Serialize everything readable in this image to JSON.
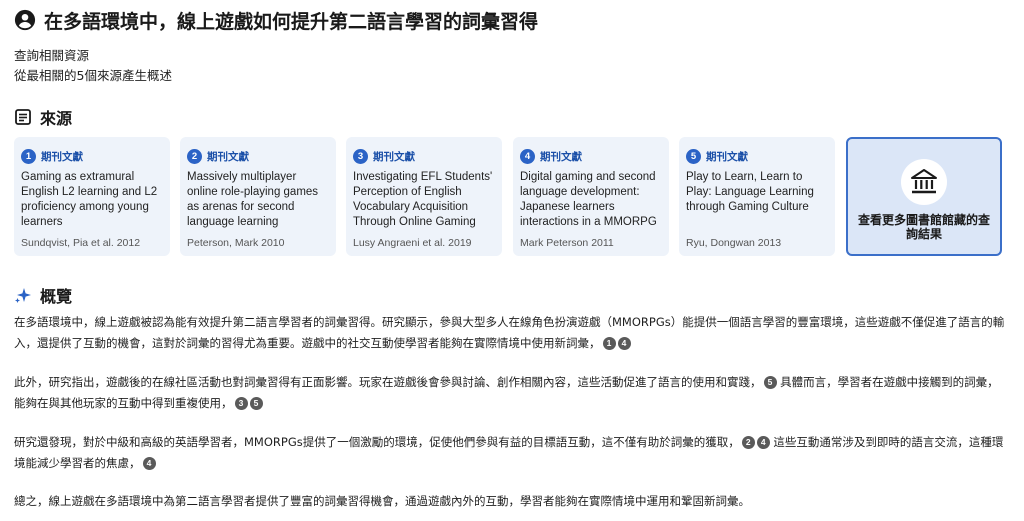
{
  "header": {
    "title": "在多語環境中，線上遊戲如何提升第二語言學習的詞彙習得",
    "icon": "user-circle-icon"
  },
  "meta": {
    "line1": "查詢相關資源",
    "line2": "從最相關的5個來源產生概述"
  },
  "sources": {
    "heading": "來源",
    "items": [
      {
        "num": "1",
        "type": "期刊文獻",
        "title": "Gaming as extramural English L2 learning and L2 proficiency among young learners",
        "author": "Sundqvist, Pia et al. 2012"
      },
      {
        "num": "2",
        "type": "期刊文獻",
        "title": "Massively multiplayer online role-playing games as arenas for second language learning",
        "author": "Peterson, Mark 2010"
      },
      {
        "num": "3",
        "type": "期刊文獻",
        "title": "Investigating EFL Students' Perception of English Vocabulary Acquisition Through Online Gaming",
        "author": "Lusy Angraeni et al. 2019"
      },
      {
        "num": "4",
        "type": "期刊文獻",
        "title": "Digital gaming and second language development: Japanese learners interactions in a MMORPG",
        "author": "Mark Peterson 2011"
      },
      {
        "num": "5",
        "type": "期刊文獻",
        "title": "Play to Learn, Learn to Play: Language Learning through Gaming Culture",
        "author": "Ryu, Dongwan 2013"
      }
    ],
    "more_label": "查看更多圖書館館藏的查詢結果"
  },
  "overview": {
    "heading": "概覽",
    "p1": {
      "text": "在多語環境中，線上遊戲被認為能有效提升第二語言學習者的詞彙習得。研究顯示，參與大型多人在線角色扮演遊戲（MMORPGs）能提供一個語言學習的豐富環境，這些遊戲不僅促進了語言的輸入，還提供了互動的機會，這對於詞彙的習得尤為重要。遊戲中的社交互動使學習者能夠在實際情境中使用新詞彙，",
      "c1": "1",
      "c2": "4"
    },
    "p2": {
      "text_a": "此外，研究指出，遊戲後的在線社區活動也對詞彙習得有正面影響。玩家在遊戲後會參與討論、創作相關內容，這些活動促進了語言的使用和實踐，",
      "c1": "5",
      "text_b": "具體而言，學習者在遊戲中接觸到的詞彙，能夠在與其他玩家的互動中得到重複使用，",
      "c2": "3",
      "c3": "5"
    },
    "p3": {
      "text_a": "研究還發現，對於中級和高級的英語學習者，MMORPGs提供了一個激勵的環境，促使他們參與有益的目標語互動，這不僅有助於詞彙的獲取，",
      "c1": "2",
      "c2": "4",
      "text_b": "這些互動通常涉及到即時的語言交流，這種環境能減少學習者的焦慮，",
      "c3": "4"
    },
    "p4": {
      "text": "總之，線上遊戲在多語環境中為第二語言學習者提供了豐富的詞彙習得機會，通過遊戲內外的互動，學習者能夠在實際情境中運用和鞏固新詞彙。"
    }
  }
}
